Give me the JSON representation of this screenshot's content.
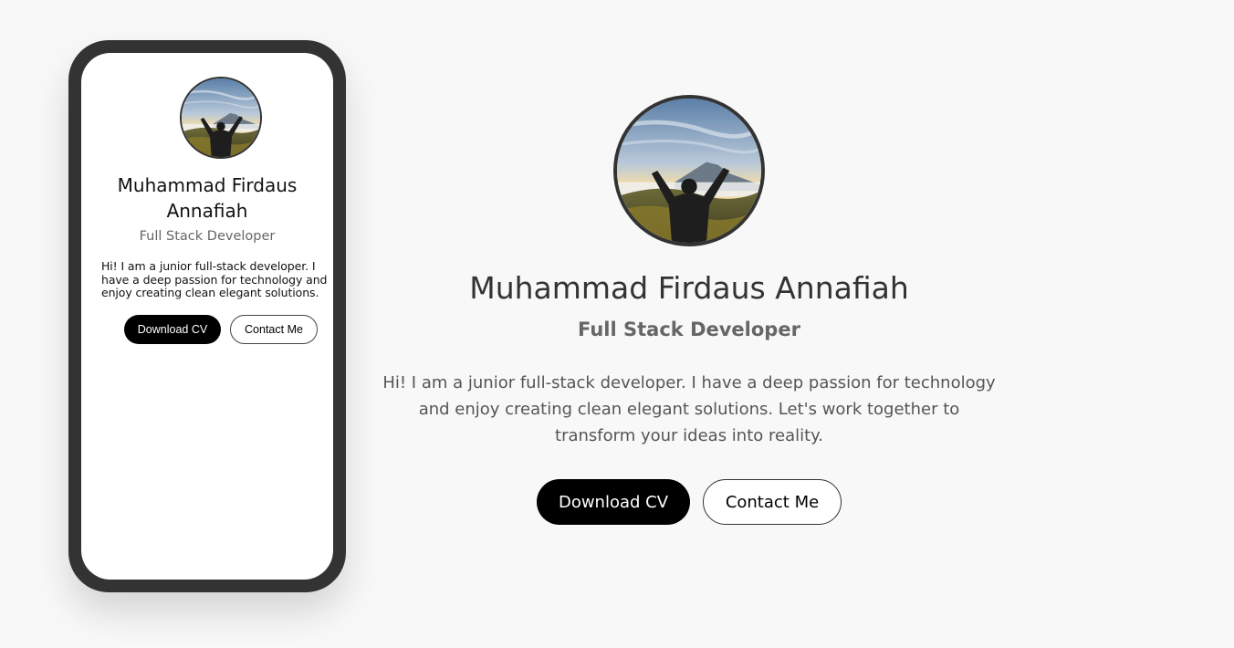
{
  "profile": {
    "name": "Muhammad Firdaus Annafiah",
    "role": "Full Stack Developer",
    "avatar_icon": "profile-photo-mountain"
  },
  "mobile_preview": {
    "bio": "Hi! I am a junior full-stack developer. I have a deep passion for technology and enjoy creating clean elegant solutions.",
    "download_label": "Download CV",
    "contact_label": "Contact Me"
  },
  "desktop": {
    "bio": "Hi! I am a junior full-stack developer. I have a deep passion for technology and enjoy creating clean elegant solutions. Let's work together to transform your ideas into reality.",
    "download_label": "Download CV",
    "contact_label": "Contact Me"
  },
  "colors": {
    "background": "#f8f8f8",
    "phone_frame": "#333333",
    "primary_button": "#000000",
    "text_muted": "#666666"
  }
}
